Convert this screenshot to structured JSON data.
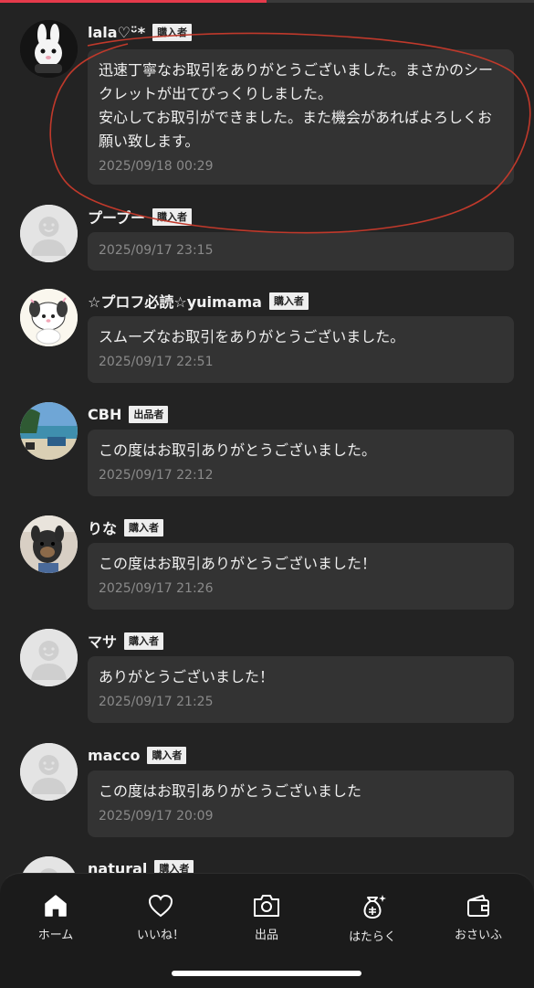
{
  "reviews": [
    {
      "name": "lala♡ᵕ̈*",
      "role": "購入者",
      "message": "迅速丁寧なお取引をありがとうございました。まさかのシークレットが出てびっくりしました。\n安心してお取引ができました。また機会があればよろしくお願い致します。",
      "timestamp": "2025/09/18 00:29",
      "avatar": "bunny-avatar"
    },
    {
      "name": "プープー",
      "role": "購入者",
      "message": "",
      "timestamp": "2025/09/17 23:15",
      "avatar": "default-avatar"
    },
    {
      "name": "☆プロフ必読☆yuimama",
      "role": "購入者",
      "message": "スムーズなお取引をありがとうございました。",
      "timestamp": "2025/09/17 22:51",
      "avatar": "dog-character-avatar"
    },
    {
      "name": "CBH",
      "role": "出品者",
      "message": "この度はお取引ありがとうございました。",
      "timestamp": "2025/09/17 22:12",
      "avatar": "beach-photo-avatar"
    },
    {
      "name": "りな",
      "role": "購入者",
      "message": "この度はお取引ありがとうございました！",
      "timestamp": "2025/09/17 21:26",
      "avatar": "dog-photo-avatar"
    },
    {
      "name": "マサ",
      "role": "購入者",
      "message": "ありがとうございました！",
      "timestamp": "2025/09/17 21:25",
      "avatar": "default-avatar"
    },
    {
      "name": "macco",
      "role": "購入者",
      "message": "この度はお取引ありがとうございました",
      "timestamp": "2025/09/17 20:09",
      "avatar": "default-avatar"
    },
    {
      "name": "natural",
      "role": "購入者",
      "message": "",
      "timestamp": "",
      "avatar": "default-avatar"
    }
  ],
  "nav": [
    {
      "label": "ホーム",
      "icon": "home-icon",
      "active": true
    },
    {
      "label": "いいね！",
      "icon": "heart-icon",
      "active": false
    },
    {
      "label": "出品",
      "icon": "camera-icon",
      "active": false
    },
    {
      "label": "はたらく",
      "icon": "money-bag-icon",
      "active": false
    },
    {
      "label": "おさいふ",
      "icon": "wallet-icon",
      "active": false
    }
  ],
  "colors": {
    "background": "#232323",
    "bubble": "#333333",
    "annotation": "#c0392b",
    "accent": "#e53a4b"
  }
}
